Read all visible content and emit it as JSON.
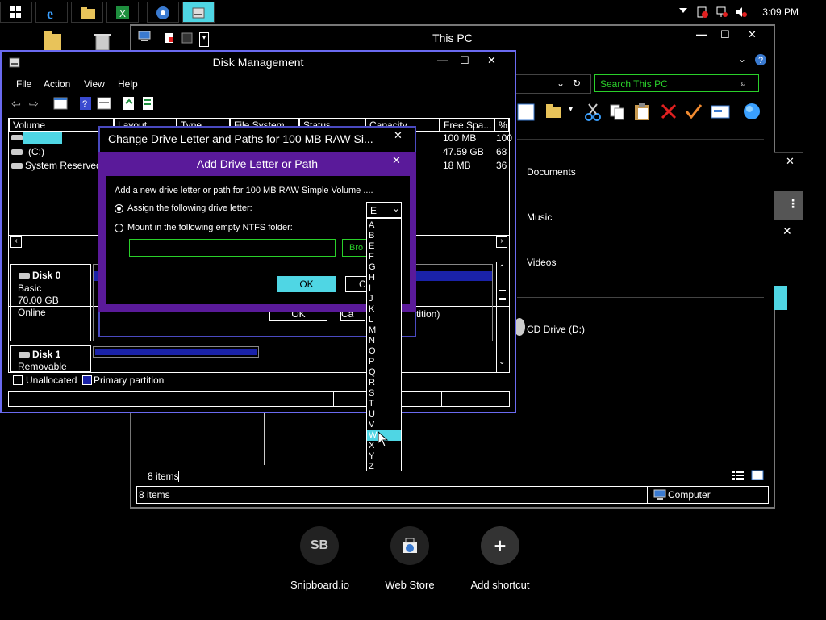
{
  "taskbar": {
    "clock": "3:09 PM",
    "apps": [
      "start-icon",
      "internet-explorer-icon",
      "file-explorer-icon",
      "excel-icon",
      "media-player-icon",
      "disk-management-icon"
    ]
  },
  "this_pc": {
    "title": "This PC",
    "search_placeholder": "Search This PC",
    "items": [
      "Documents",
      "Music",
      "Videos",
      "CD Drive (D:)"
    ],
    "items_count": "8 items",
    "status_count": "8 items",
    "status_location": "Computer"
  },
  "disk_mgmt": {
    "title": "Disk Management",
    "menu": [
      "File",
      "Action",
      "View",
      "Help"
    ],
    "columns": [
      "Volume",
      "Layout",
      "Type",
      "File System",
      "Status",
      "Capacity",
      "Free Spa...",
      "% F"
    ],
    "volumes": [
      {
        "name": "",
        "free": "100 MB",
        "pct": "100"
      },
      {
        "name": "(C:)",
        "free": "47.59 GB",
        "pct": "68"
      },
      {
        "name": "System Reserved",
        "free": "18 MB",
        "pct": "36"
      }
    ],
    "disk0": {
      "name": "Disk 0",
      "type": "Basic",
      "size": "70.00 GB",
      "status": "Online"
    },
    "disk1": {
      "name": "Disk 1",
      "type": "Removable"
    },
    "legend": [
      "Unallocated",
      "Primary partition"
    ],
    "partition_fragment": "tition)"
  },
  "change_dialog": {
    "title": "Change Drive Letter and Paths for 100 MB RAW Si...",
    "ok": "OK",
    "cancel_fragment": "Ca"
  },
  "add_dialog": {
    "title": "Add Drive Letter or Path",
    "description": "Add a new drive letter or path for 100 MB RAW Simple Volume ....",
    "option_assign": "Assign the following drive letter:",
    "option_mount": "Mount in the following empty NTFS folder:",
    "browse_fragment": "Bro",
    "ok": "OK",
    "cancel_fragment": "Ca",
    "selected_letter": "E",
    "letters": [
      "A",
      "B",
      "E",
      "F",
      "G",
      "H",
      "I",
      "J",
      "K",
      "L",
      "M",
      "N",
      "O",
      "P",
      "Q",
      "R",
      "S",
      "T",
      "U",
      "V",
      "W",
      "X",
      "Y",
      "Z"
    ],
    "highlighted_letter": "W"
  },
  "shortcuts": [
    {
      "label": "Snipboard.io",
      "icon_text": "SB"
    },
    {
      "label": "Web Store",
      "icon_text": ""
    },
    {
      "label": "Add shortcut",
      "icon_text": "+"
    }
  ],
  "colors": {
    "accent": "#6a6af0",
    "cyan": "#4fd6e4",
    "green": "#2ad02a",
    "purple": "#5a1a9a",
    "blue": "#1a22a8"
  }
}
